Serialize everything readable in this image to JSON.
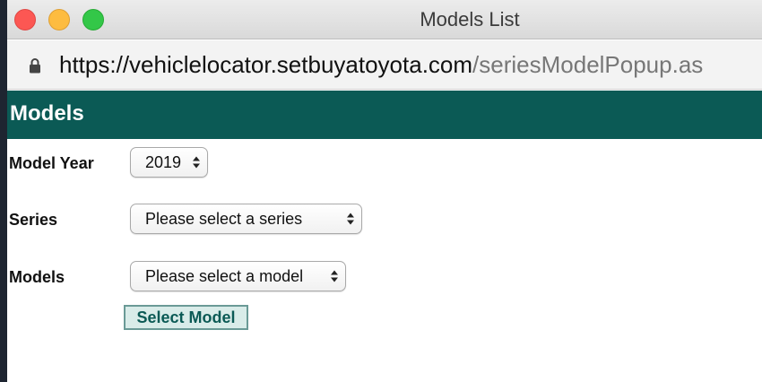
{
  "window": {
    "title": "Models List"
  },
  "address_bar": {
    "host": "https://vehiclelocator.setbuyatoyota.com",
    "path": "/seriesModelPopup.as",
    "icon": "lock-icon"
  },
  "page": {
    "header": "Models",
    "fields": {
      "model_year": {
        "label": "Model Year",
        "value": "2019"
      },
      "series": {
        "label": "Series",
        "value": "Please select a series"
      },
      "models": {
        "label": "Models",
        "value": "Please select a model"
      }
    },
    "button_label": "Select Model"
  },
  "colors": {
    "header_bg": "#0b5a55",
    "button_bg": "#d9ece9",
    "close": "#fc5753",
    "minimize": "#fdbc40",
    "zoom": "#33c748"
  }
}
